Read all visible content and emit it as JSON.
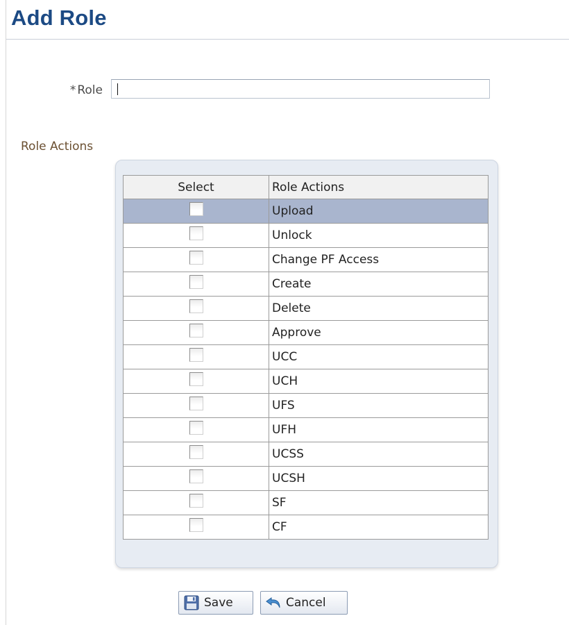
{
  "page": {
    "title": "Add Role"
  },
  "role_field": {
    "required_marker": "*",
    "label": "Role",
    "value": ""
  },
  "role_actions": {
    "section_label": "Role Actions",
    "columns": {
      "select": "Select",
      "action": "Role Actions"
    },
    "selected_row": 0,
    "rows": [
      {
        "label": "Upload",
        "checked": false
      },
      {
        "label": "Unlock",
        "checked": false
      },
      {
        "label": "Change PF Access",
        "checked": false
      },
      {
        "label": "Create",
        "checked": false
      },
      {
        "label": "Delete",
        "checked": false
      },
      {
        "label": "Approve",
        "checked": false
      },
      {
        "label": "UCC",
        "checked": false
      },
      {
        "label": "UCH",
        "checked": false
      },
      {
        "label": "UFS",
        "checked": false
      },
      {
        "label": "UFH",
        "checked": false
      },
      {
        "label": "UCSS",
        "checked": false
      },
      {
        "label": "UCSH",
        "checked": false
      },
      {
        "label": "SF",
        "checked": false
      },
      {
        "label": "CF",
        "checked": false
      }
    ]
  },
  "buttons": {
    "save": {
      "label": "Save",
      "icon": "floppy-disk-icon"
    },
    "cancel": {
      "label": "Cancel",
      "icon": "undo-arrow-icon"
    }
  },
  "colors": {
    "title": "#1c4a84",
    "section_label": "#6b5032",
    "selected_row": "#a9b5ce",
    "panel": "#e7ecf3"
  }
}
